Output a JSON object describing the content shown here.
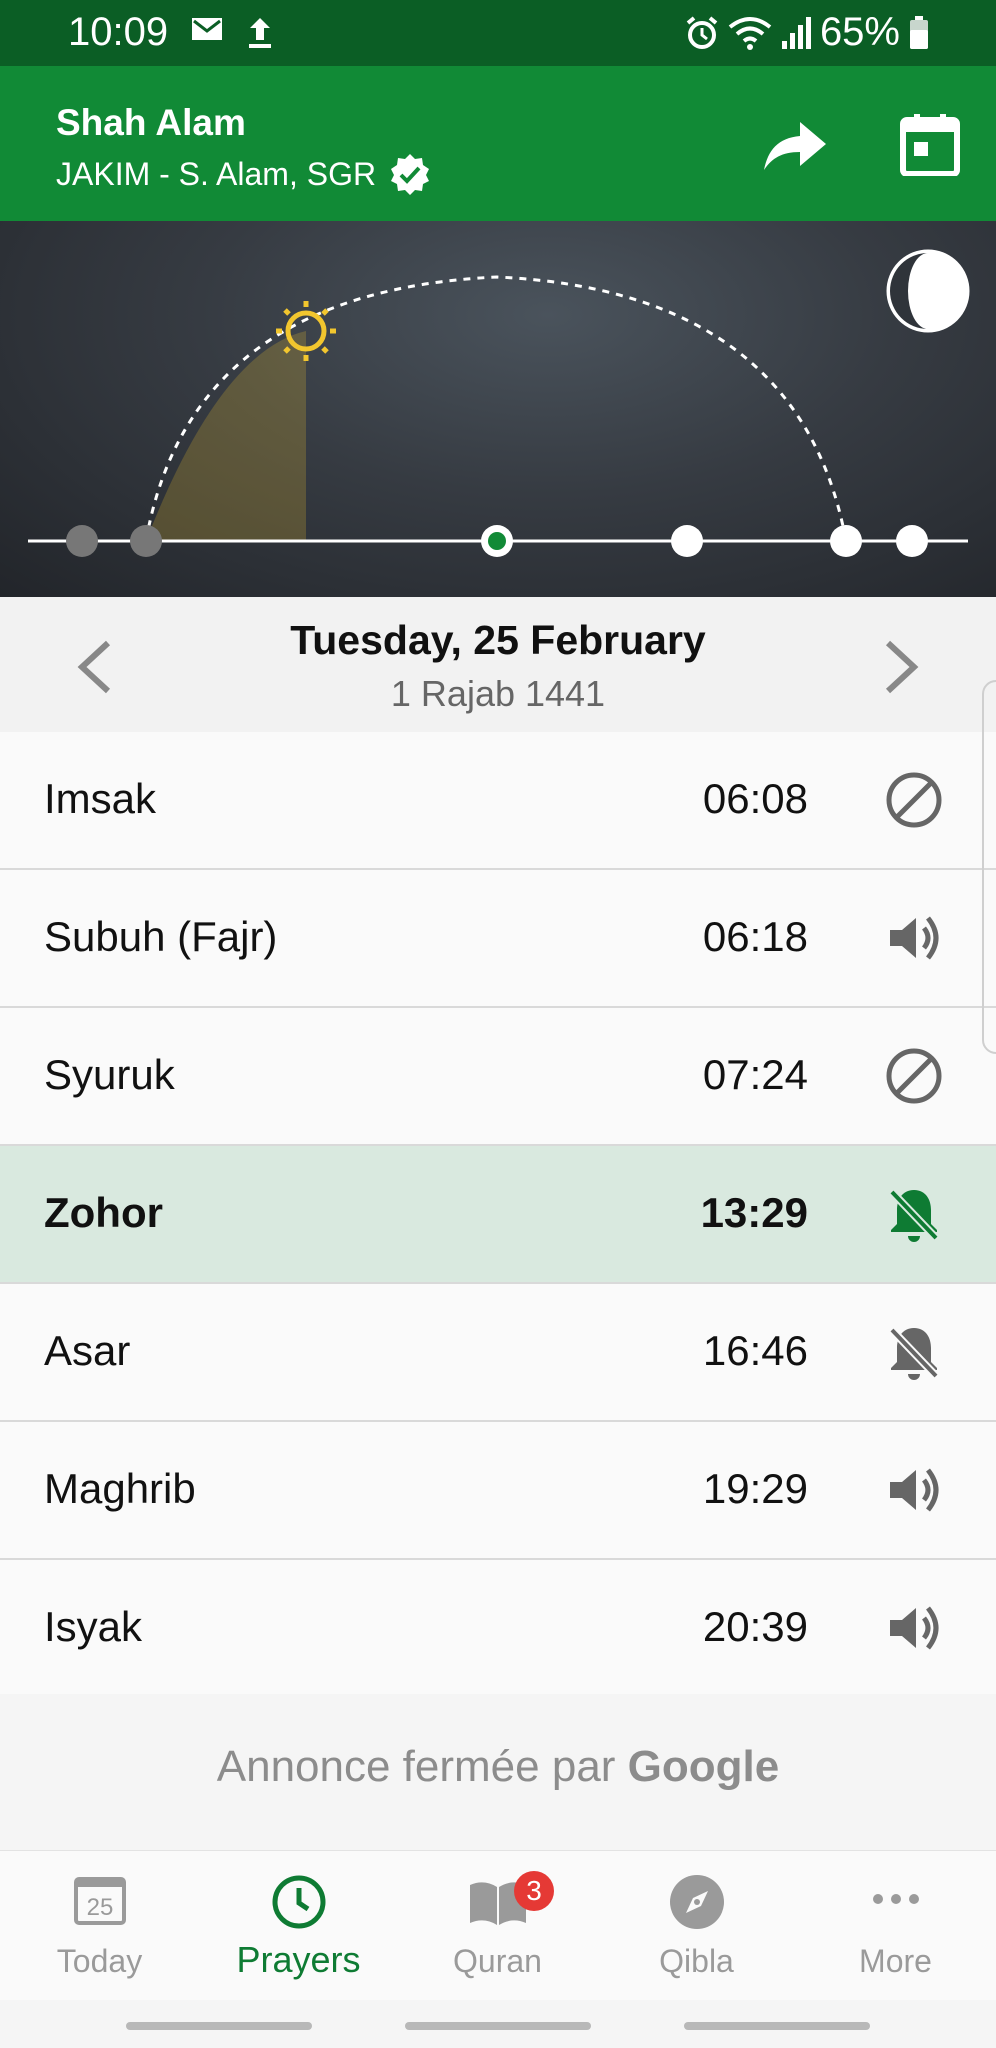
{
  "status_bar": {
    "time": "10:09",
    "battery": "65%"
  },
  "header": {
    "city": "Shah Alam",
    "zone": "JAKIM - S. Alam, SGR"
  },
  "date": {
    "gregorian": "Tuesday, 25 February",
    "hijri": "1 Rajab 1441"
  },
  "prayers": [
    {
      "name": "Imsak",
      "time": "06:08",
      "alert": "off",
      "active": false
    },
    {
      "name": "Subuh (Fajr)",
      "time": "06:18",
      "alert": "sound",
      "active": false
    },
    {
      "name": "Syuruk",
      "time": "07:24",
      "alert": "off",
      "active": false
    },
    {
      "name": "Zohor",
      "time": "13:29",
      "alert": "silent",
      "active": true
    },
    {
      "name": "Asar",
      "time": "16:46",
      "alert": "silent",
      "active": false
    },
    {
      "name": "Maghrib",
      "time": "19:29",
      "alert": "sound",
      "active": false
    },
    {
      "name": "Isyak",
      "time": "20:39",
      "alert": "sound",
      "active": false
    }
  ],
  "ad": {
    "text": "Annonce fermée par",
    "brand": "Google"
  },
  "bottom_nav": [
    {
      "label": "Today",
      "icon": "calendar-25-icon",
      "calendar_day": "25"
    },
    {
      "label": "Prayers",
      "icon": "clock-icon",
      "active": true
    },
    {
      "label": "Quran",
      "icon": "book-icon",
      "badge": "3"
    },
    {
      "label": "Qibla",
      "icon": "compass-icon"
    },
    {
      "label": "More",
      "icon": "more-dots-icon"
    }
  ],
  "colors": {
    "status_bar": "#0b5e25",
    "header": "#118a36",
    "accent": "#0e7b33",
    "active_row": "#d9e9df",
    "sun": "#f2c62e",
    "badge": "#e53935"
  }
}
